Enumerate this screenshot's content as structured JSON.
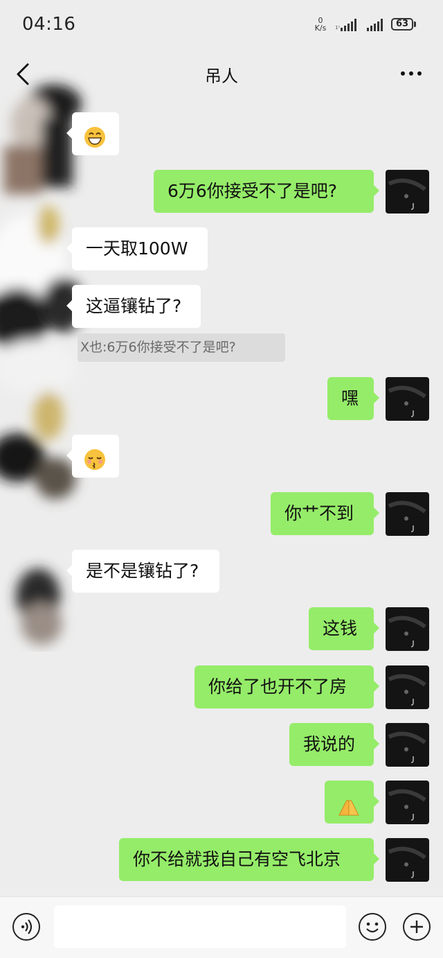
{
  "status_bar": {
    "time": "04:16",
    "net_speed_value": "0",
    "net_speed_unit": "K/s",
    "battery": "63"
  },
  "header": {
    "title": "吊人"
  },
  "messages": [
    {
      "side": "left",
      "text": "😁"
    },
    {
      "side": "right",
      "text": "6万6你接受不了是吧?"
    },
    {
      "side": "left",
      "text": "一天取100W"
    },
    {
      "side": "left",
      "text": "这逼镶钻了?"
    },
    {
      "side": "quote",
      "text": "X也:6万6你接受不了是吧?"
    },
    {
      "side": "right",
      "text": "嘿"
    },
    {
      "side": "left",
      "text": "😚"
    },
    {
      "side": "right",
      "text": "你艹不到"
    },
    {
      "side": "left",
      "text": "是不是镶钻了?"
    },
    {
      "side": "right",
      "text": "这钱"
    },
    {
      "side": "right",
      "text": "你给了也开不了房"
    },
    {
      "side": "right",
      "text": "我说的"
    },
    {
      "side": "right",
      "text": "🙏"
    },
    {
      "side": "right",
      "text": "你不给就我自己有空飞北京"
    }
  ],
  "input": {
    "placeholder": ""
  },
  "icons": {
    "back": "chevron-left-icon",
    "more": "more-dots-icon",
    "voice": "voice-icon",
    "emoji": "emoji-icon",
    "plus": "plus-icon"
  },
  "colors": {
    "background": "#ededed",
    "sent_bubble": "#95ec69",
    "received_bubble": "#ffffff",
    "quote_bg": "#dcdcdc"
  }
}
